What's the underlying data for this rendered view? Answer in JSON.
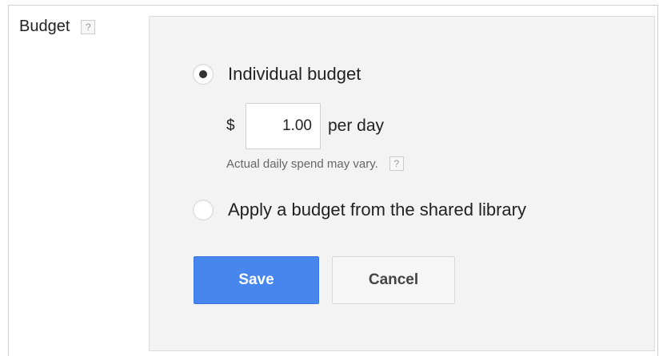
{
  "field": {
    "label": "Budget",
    "help_glyph": "?"
  },
  "options": {
    "individual": {
      "label": "Individual budget",
      "selected": true
    },
    "shared": {
      "label": "Apply a budget from the shared library",
      "selected": false
    }
  },
  "amount": {
    "currency_symbol": "$",
    "value": "1.00",
    "unit": "per day",
    "note": "Actual daily spend may vary.",
    "note_help_glyph": "?"
  },
  "buttons": {
    "save_label": "Save",
    "cancel_label": "Cancel"
  },
  "colors": {
    "save_button": "#4787ed",
    "panel_background": "#f3f3f3"
  }
}
